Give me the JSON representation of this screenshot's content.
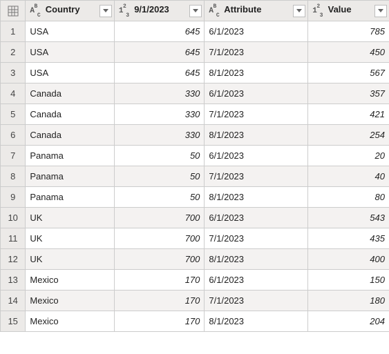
{
  "columns": [
    {
      "key": "country",
      "label": "Country",
      "type": "text"
    },
    {
      "key": "sep",
      "label": "9/1/2023",
      "type": "number"
    },
    {
      "key": "attr",
      "label": "Attribute",
      "type": "text"
    },
    {
      "key": "value",
      "label": "Value",
      "type": "number"
    }
  ],
  "rows": [
    {
      "n": "1",
      "country": "USA",
      "sep": "645",
      "attr": "6/1/2023",
      "value": "785"
    },
    {
      "n": "2",
      "country": "USA",
      "sep": "645",
      "attr": "7/1/2023",
      "value": "450"
    },
    {
      "n": "3",
      "country": "USA",
      "sep": "645",
      "attr": "8/1/2023",
      "value": "567"
    },
    {
      "n": "4",
      "country": "Canada",
      "sep": "330",
      "attr": "6/1/2023",
      "value": "357"
    },
    {
      "n": "5",
      "country": "Canada",
      "sep": "330",
      "attr": "7/1/2023",
      "value": "421"
    },
    {
      "n": "6",
      "country": "Canada",
      "sep": "330",
      "attr": "8/1/2023",
      "value": "254"
    },
    {
      "n": "7",
      "country": "Panama",
      "sep": "50",
      "attr": "6/1/2023",
      "value": "20"
    },
    {
      "n": "8",
      "country": "Panama",
      "sep": "50",
      "attr": "7/1/2023",
      "value": "40"
    },
    {
      "n": "9",
      "country": "Panama",
      "sep": "50",
      "attr": "8/1/2023",
      "value": "80"
    },
    {
      "n": "10",
      "country": "UK",
      "sep": "700",
      "attr": "6/1/2023",
      "value": "543"
    },
    {
      "n": "11",
      "country": "UK",
      "sep": "700",
      "attr": "7/1/2023",
      "value": "435"
    },
    {
      "n": "12",
      "country": "UK",
      "sep": "700",
      "attr": "8/1/2023",
      "value": "400"
    },
    {
      "n": "13",
      "country": "Mexico",
      "sep": "170",
      "attr": "6/1/2023",
      "value": "150"
    },
    {
      "n": "14",
      "country": "Mexico",
      "sep": "170",
      "attr": "7/1/2023",
      "value": "180"
    },
    {
      "n": "15",
      "country": "Mexico",
      "sep": "170",
      "attr": "8/1/2023",
      "value": "204"
    }
  ],
  "chart_data": {
    "type": "table",
    "columns": [
      "Country",
      "9/1/2023",
      "Attribute",
      "Value"
    ],
    "rows": [
      [
        "USA",
        645,
        "6/1/2023",
        785
      ],
      [
        "USA",
        645,
        "7/1/2023",
        450
      ],
      [
        "USA",
        645,
        "8/1/2023",
        567
      ],
      [
        "Canada",
        330,
        "6/1/2023",
        357
      ],
      [
        "Canada",
        330,
        "7/1/2023",
        421
      ],
      [
        "Canada",
        330,
        "8/1/2023",
        254
      ],
      [
        "Panama",
        50,
        "6/1/2023",
        20
      ],
      [
        "Panama",
        50,
        "7/1/2023",
        40
      ],
      [
        "Panama",
        50,
        "8/1/2023",
        80
      ],
      [
        "UK",
        700,
        "6/1/2023",
        543
      ],
      [
        "UK",
        700,
        "7/1/2023",
        435
      ],
      [
        "UK",
        700,
        "8/1/2023",
        400
      ],
      [
        "Mexico",
        170,
        "6/1/2023",
        150
      ],
      [
        "Mexico",
        170,
        "7/1/2023",
        180
      ],
      [
        "Mexico",
        170,
        "8/1/2023",
        204
      ]
    ]
  }
}
